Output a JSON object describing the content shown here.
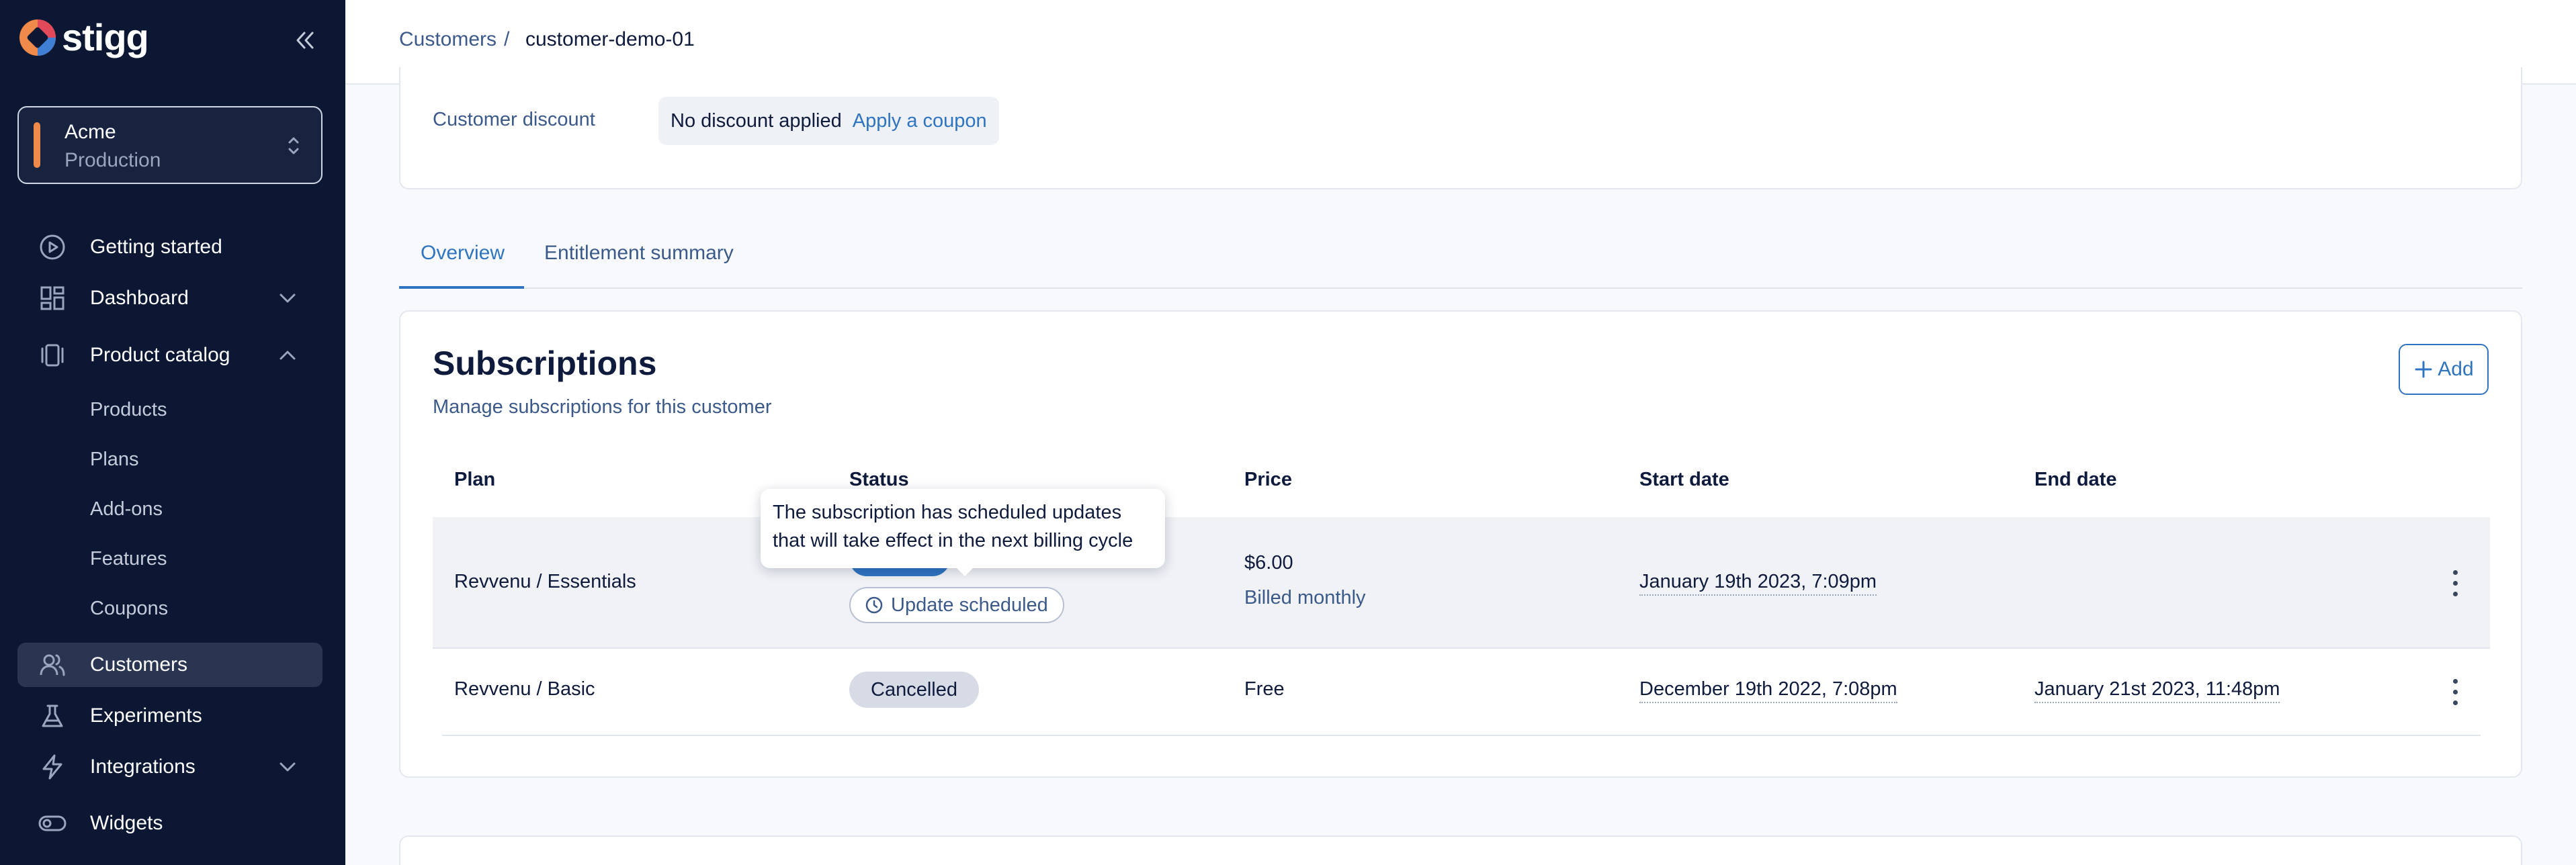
{
  "brand": {
    "name": "stigg",
    "accent": "#2f74c0",
    "env_color": "#f08a4b"
  },
  "environment": {
    "name": "Acme",
    "type": "Production"
  },
  "sidebar": {
    "items": [
      {
        "label": "Getting started",
        "icon": "play-circle-icon"
      },
      {
        "label": "Dashboard",
        "icon": "dashboard-icon"
      },
      {
        "label": "Product catalog",
        "icon": "catalog-icon"
      },
      {
        "label": "Customers",
        "icon": "users-icon"
      },
      {
        "label": "Experiments",
        "icon": "flask-icon"
      },
      {
        "label": "Integrations",
        "icon": "bolt-icon"
      },
      {
        "label": "Widgets",
        "icon": "toggle-icon"
      }
    ],
    "catalog_sub_items": [
      "Products",
      "Plans",
      "Add-ons",
      "Features",
      "Coupons"
    ]
  },
  "breadcrumb": {
    "parent": "Customers",
    "separator": "/",
    "current": "customer-demo-01"
  },
  "discount": {
    "label": "Customer discount",
    "value": "No discount applied",
    "action": "Apply a coupon"
  },
  "tabs": [
    {
      "label": "Overview",
      "active": true
    },
    {
      "label": "Entitlement summary",
      "active": false
    }
  ],
  "subscriptions": {
    "title": "Subscriptions",
    "subtitle": "Manage subscriptions for this customer",
    "add_label": "Add",
    "columns": [
      "Plan",
      "Status",
      "Price",
      "Start date",
      "End date"
    ],
    "rows": [
      {
        "plan": "Revvenu / Essentials",
        "status_badge": "Update scheduled",
        "price": "$6.00",
        "billing": "Billed monthly",
        "start": "January 19th 2023, 7:09pm",
        "end": ""
      },
      {
        "plan": "Revvenu / Basic",
        "status": "Cancelled",
        "price": "Free",
        "start": "December 19th 2022, 7:08pm",
        "end": "January 21st 2023, 11:48pm"
      }
    ]
  },
  "tooltip": {
    "line1": "The subscription has scheduled updates",
    "line2": "that will take effect in the next billing cycle"
  }
}
